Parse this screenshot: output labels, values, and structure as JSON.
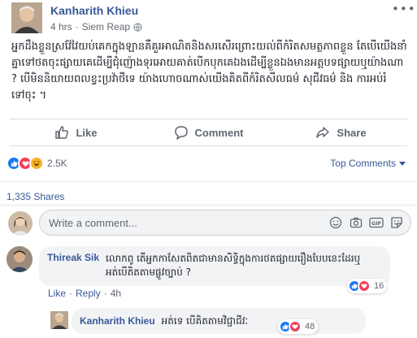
{
  "post": {
    "author": "Kanharith Khieu",
    "time": "4 hrs",
    "location": "Siem Reap",
    "text": "អ្នកដឹងខ្លួនស្រវ៉ែវៃយប់គេកក្នុងឡានគឺគួរអាណិតនិងសរសើរព្រោះយល់ពីកំរិតសមត្ថភាពខ្លួន តែបើយើងនាំគ្នាទៅថតចុះផ្សាយគេដើម្បីជុំញ៉ោងទុរអោយគាត់បើកបុកគេឯងដើម្បីខ្លួនឯងមានអត្តបទផ្សាយឬយ៉ាងណា ? បើមិននិយាយពលខ្វះប្រវ៉ាថីទេ យ៉ាងហោចណាស់យើងគិតពីកំរិតសីលធម៌ សុជីវធម៌ និង ការអប់រំទៅចុះ ។"
  },
  "actions": {
    "like": "Like",
    "comment": "Comment",
    "share": "Share"
  },
  "reactions": {
    "count": "2.5K",
    "types": [
      "like-icon",
      "love-icon",
      "haha-icon"
    ],
    "colors": {
      "like": "#1877f2",
      "love": "#f33e58",
      "haha": "#f7b125"
    }
  },
  "top_comments_label": "Top Comments",
  "shares": "1,335 Shares",
  "compose": {
    "placeholder": "Write a comment...",
    "icons": [
      "emoji-icon",
      "camera-icon",
      "gif-icon",
      "sticker-icon"
    ]
  },
  "comments": [
    {
      "author": "Thireak Sik",
      "text": "លោកពូ តើអ្នកកាសែតពិតជាមានសិទ្ធិក្នុងការថតផ្សាយរឿងបែបនេះដែរឬអត់បើតិតតាមផ្លូវច្បាប់ ?",
      "like_label": "Like",
      "reply_label": "Reply",
      "time": "4h",
      "reaction_count": "16"
    }
  ],
  "replies": [
    {
      "author": "Kanharith Khieu",
      "text": "អត់ទេ បើគិតតាមវិជ្ជាជីវៈ",
      "reaction_count": "48"
    }
  ],
  "brand_color": "#385898"
}
